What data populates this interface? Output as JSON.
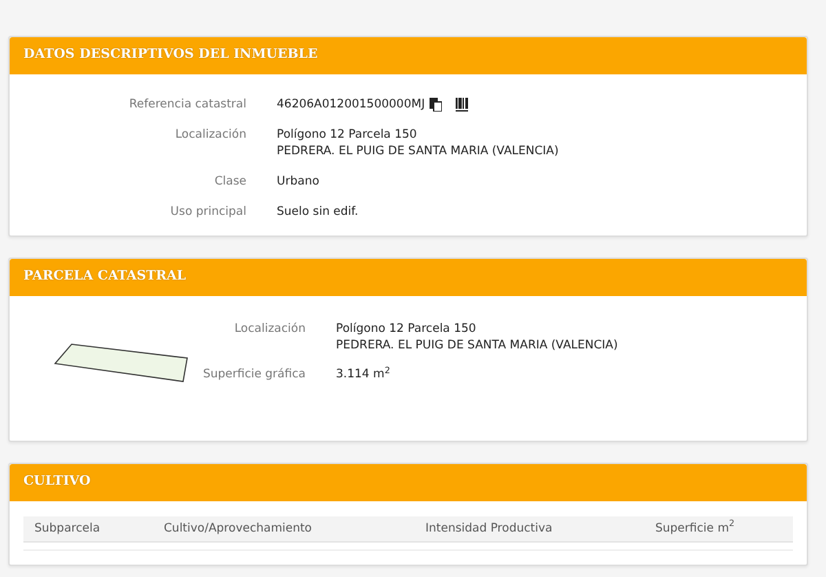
{
  "inmueble": {
    "title": "DATOS DESCRIPTIVOS DEL INMUEBLE",
    "fields": [
      {
        "label": "Referencia catastral",
        "lines": [
          "46206A012001500000MJ"
        ],
        "kind": "reference"
      },
      {
        "label": "Localización",
        "lines": [
          "Polígono 12 Parcela 150",
          "PEDRERA. EL PUIG DE SANTA MARIA (VALENCIA)"
        ],
        "kind": "text"
      },
      {
        "label": "Clase",
        "lines": [
          "Urbano"
        ],
        "kind": "text"
      },
      {
        "label": "Uso principal",
        "lines": [
          "Suelo sin edif."
        ],
        "kind": "text"
      }
    ]
  },
  "parcela": {
    "title": "PARCELA CATASTRAL",
    "fields": [
      {
        "label": "Localización",
        "lines": [
          "Polígono 12 Parcela 150",
          "PEDRERA. EL PUIG DE SANTA MARIA (VALENCIA)"
        ]
      },
      {
        "label": "Superficie gráfica",
        "lines": [
          "3.114 m$^{2}$"
        ]
      }
    ]
  },
  "cultivo": {
    "title": "CULTIVO",
    "columns": [
      "Subparcela",
      "Cultivo/Aprovechamiento",
      "Intensidad Productiva",
      "Superficie m$^{2}$"
    ]
  }
}
